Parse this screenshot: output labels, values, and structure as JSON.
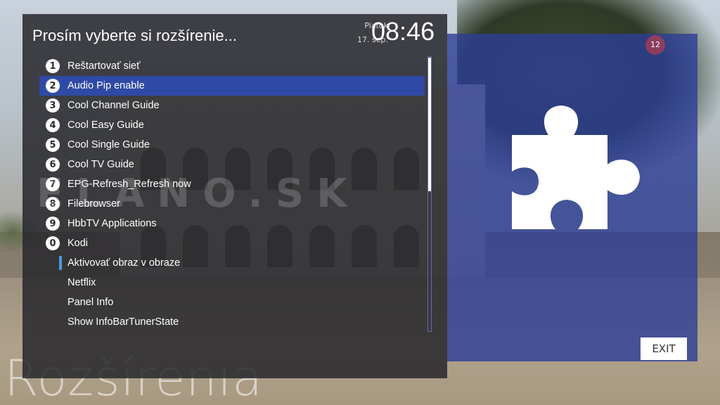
{
  "background": {
    "caption": "Rozšírenia",
    "watermark": "ELANO.SK"
  },
  "dialog": {
    "title": "Prosím vyberte si rozšírenie...",
    "day": "Piatok",
    "date": "17. sep.",
    "time": "08:46"
  },
  "menu": {
    "items": [
      {
        "num": "1",
        "label": "Reštartovať sieť"
      },
      {
        "num": "2",
        "label": "Audio Pip enable"
      },
      {
        "num": "3",
        "label": "Cool Channel Guide"
      },
      {
        "num": "4",
        "label": "Cool Easy Guide"
      },
      {
        "num": "5",
        "label": "Cool Single Guide"
      },
      {
        "num": "6",
        "label": "Cool TV Guide"
      },
      {
        "num": "7",
        "label": "EPG-Refresh_Refresh now"
      },
      {
        "num": "8",
        "label": "Filebrowser"
      },
      {
        "num": "9",
        "label": "HbbTV Applications"
      },
      {
        "num": "0",
        "label": "Kodi"
      },
      {
        "num": "",
        "label": "Aktivovať obraz v obraze"
      },
      {
        "num": "",
        "label": "Netflix"
      },
      {
        "num": "",
        "label": "Panel Info"
      },
      {
        "num": "",
        "label": "Show InfoBarTunerState"
      }
    ],
    "selected_index": 1
  },
  "side_panel": {
    "icon": "puzzle-piece-icon",
    "badge": "12",
    "exit_label": "EXIT"
  },
  "colors": {
    "selection": "#2f4aa6",
    "panel_blue": "#2c3e96",
    "marker": "#4a9ae0"
  }
}
